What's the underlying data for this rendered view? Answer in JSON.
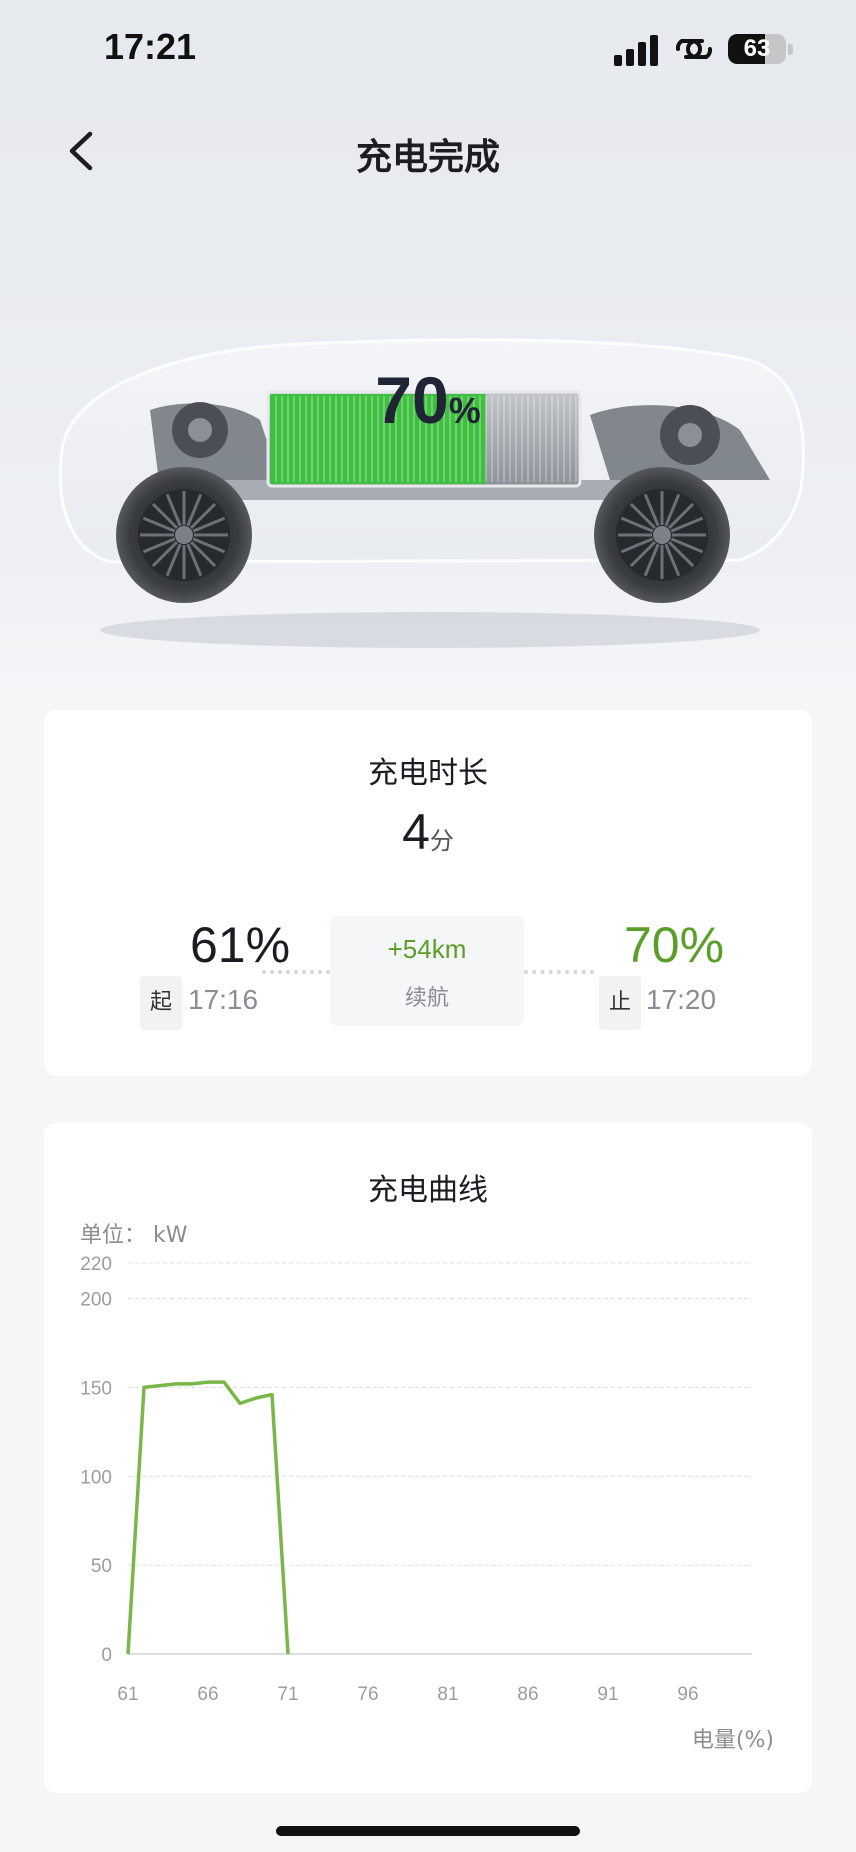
{
  "status_bar": {
    "time": "17:21",
    "battery_level": "63",
    "battery_fraction": 0.63
  },
  "header": {
    "title": "充电完成"
  },
  "battery": {
    "percent": "70",
    "unit": "%",
    "fill_fraction": 0.7
  },
  "duration_card": {
    "title": "充电时长",
    "duration_value": "4",
    "duration_unit": "分",
    "start_percent": "61%",
    "start_tag": "起",
    "start_time": "17:16",
    "range_added": "+54km",
    "range_label": "续航",
    "end_percent": "70%",
    "end_tag": "止",
    "end_time": "17:20"
  },
  "curve_card": {
    "title": "充电曲线",
    "unit_label": "单位：  kW",
    "x_unit_label": "电量(%)"
  },
  "colors": {
    "accent_green": "#5c9e2a",
    "line_green": "#7ab648"
  },
  "chart_data": {
    "type": "line",
    "title": "充电曲线",
    "ylabel": "单位：  kW",
    "xlabel": "电量(%)",
    "x_ticks": [
      61,
      66,
      71,
      76,
      81,
      86,
      91,
      96
    ],
    "y_ticks": [
      0,
      50,
      100,
      150,
      200,
      220
    ],
    "xlim": [
      61,
      100
    ],
    "ylim": [
      0,
      220
    ],
    "grid": true,
    "series": [
      {
        "x": [
          61,
          62,
          63,
          64,
          65,
          66,
          67,
          68,
          69,
          70,
          71
        ],
        "y": [
          0,
          150,
          151,
          152,
          152,
          153,
          153,
          141,
          144,
          146,
          0
        ]
      }
    ]
  }
}
